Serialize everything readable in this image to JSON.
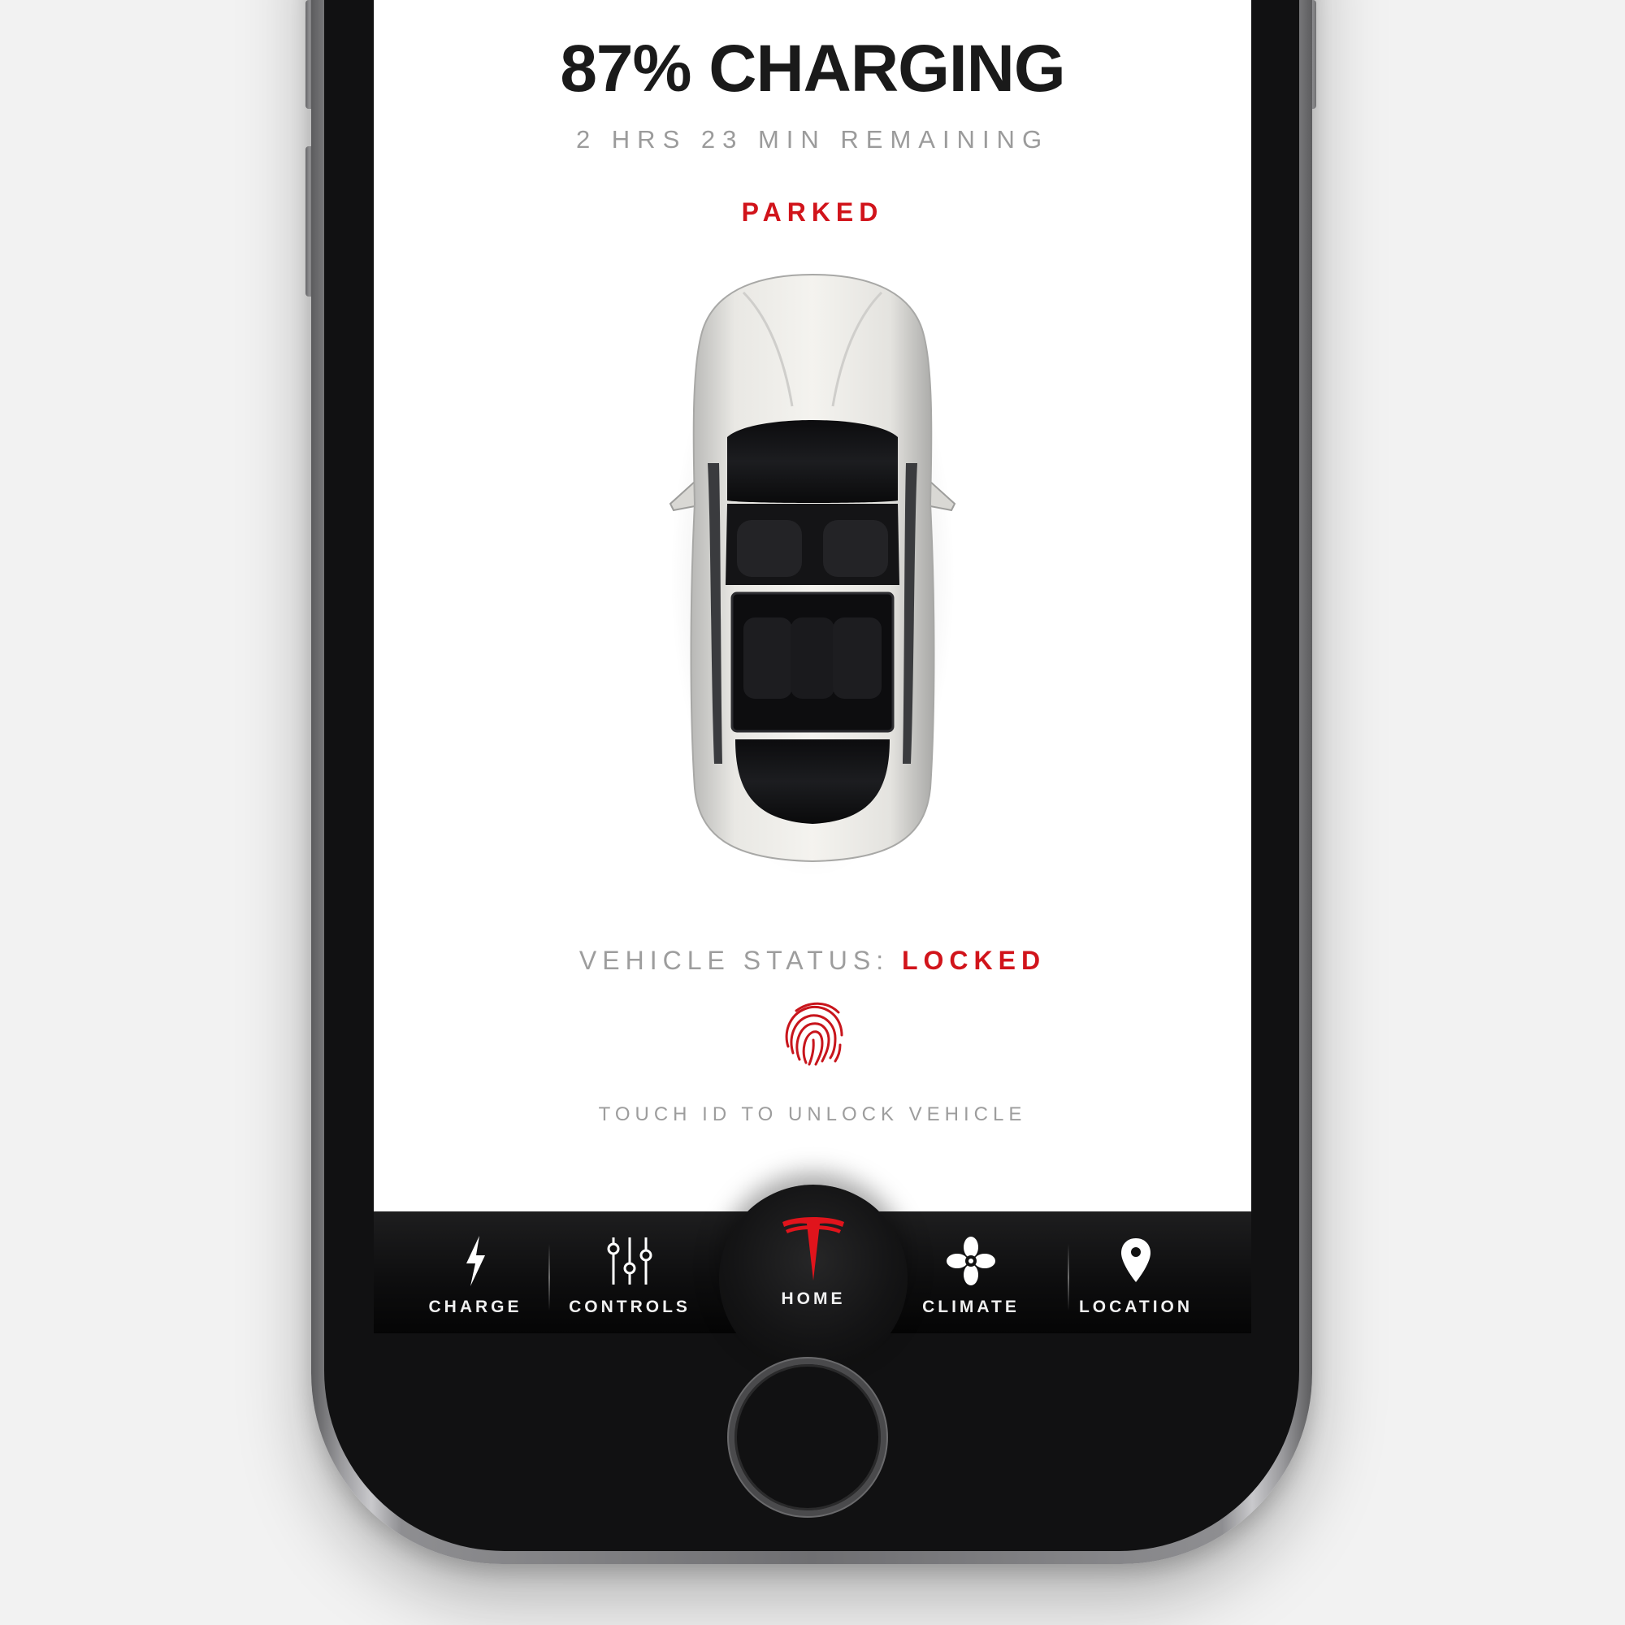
{
  "header": {
    "charge_status": "87% CHARGING",
    "time_remaining": "2 HRS 23 MIN REMAINING",
    "drive_state": "PARKED"
  },
  "vehicle": {
    "status_label": "VEHICLE STATUS:",
    "status_value": "LOCKED",
    "touch_hint": "TOUCH ID TO UNLOCK VEHICLE"
  },
  "tabbar": {
    "items": [
      {
        "label": "CHARGE",
        "icon": "lightning-bolt-icon"
      },
      {
        "label": "CONTROLS",
        "icon": "sliders-icon"
      },
      {
        "label": "HOME",
        "icon": "tesla-logo-icon",
        "active": true
      },
      {
        "label": "CLIMATE",
        "icon": "fan-icon"
      },
      {
        "label": "LOCATION",
        "icon": "map-pin-icon"
      }
    ]
  },
  "colors": {
    "accent_red": "#d1141b",
    "text_dark": "#1a1a1a",
    "text_muted": "#9b9b9b",
    "tabbar_bg": "#0e0e0f"
  }
}
